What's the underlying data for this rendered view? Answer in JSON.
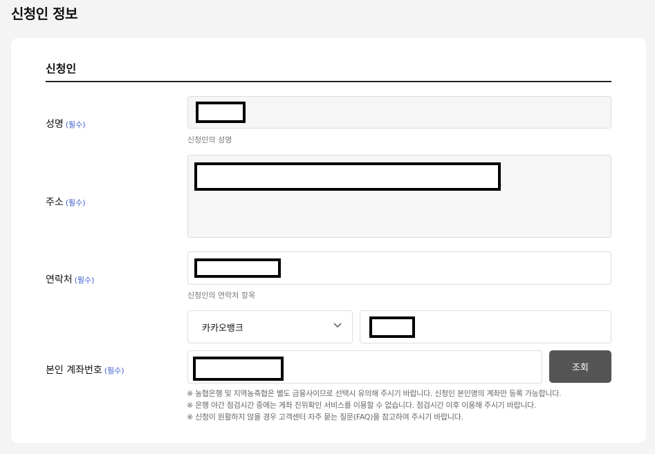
{
  "page_title": "신청인 정보",
  "section_title": "신청인",
  "required_mark": "(필수)",
  "fields": {
    "name": {
      "label": "성명",
      "hint": "신청인의 성명"
    },
    "address": {
      "label": "주소"
    },
    "contact": {
      "label": "연락처",
      "hint": "신청인의 연락처 항목"
    },
    "account": {
      "label": "본인 계좌번호",
      "bank_selected": "카카오뱅크",
      "lookup_button": "조회"
    }
  },
  "notes": [
    "※ 농협은행 및 지역농축협은 별도 금융사이므로 선택시 유의해 주시기 바랍니다. 신청인 본인명의 계좌만 등록 가능합니다.",
    "※ 은행 야간 점검시간 중에는 계좌 진위확인 서비스를 이용할 수 없습니다. 점검시간 이후 이용해 주시기 바랍니다.",
    "※ 신청이 원활하지 않을 경우 고객센터 자주 묻는 질문(FAQ)을 참고하여 주시기 바랍니다."
  ]
}
